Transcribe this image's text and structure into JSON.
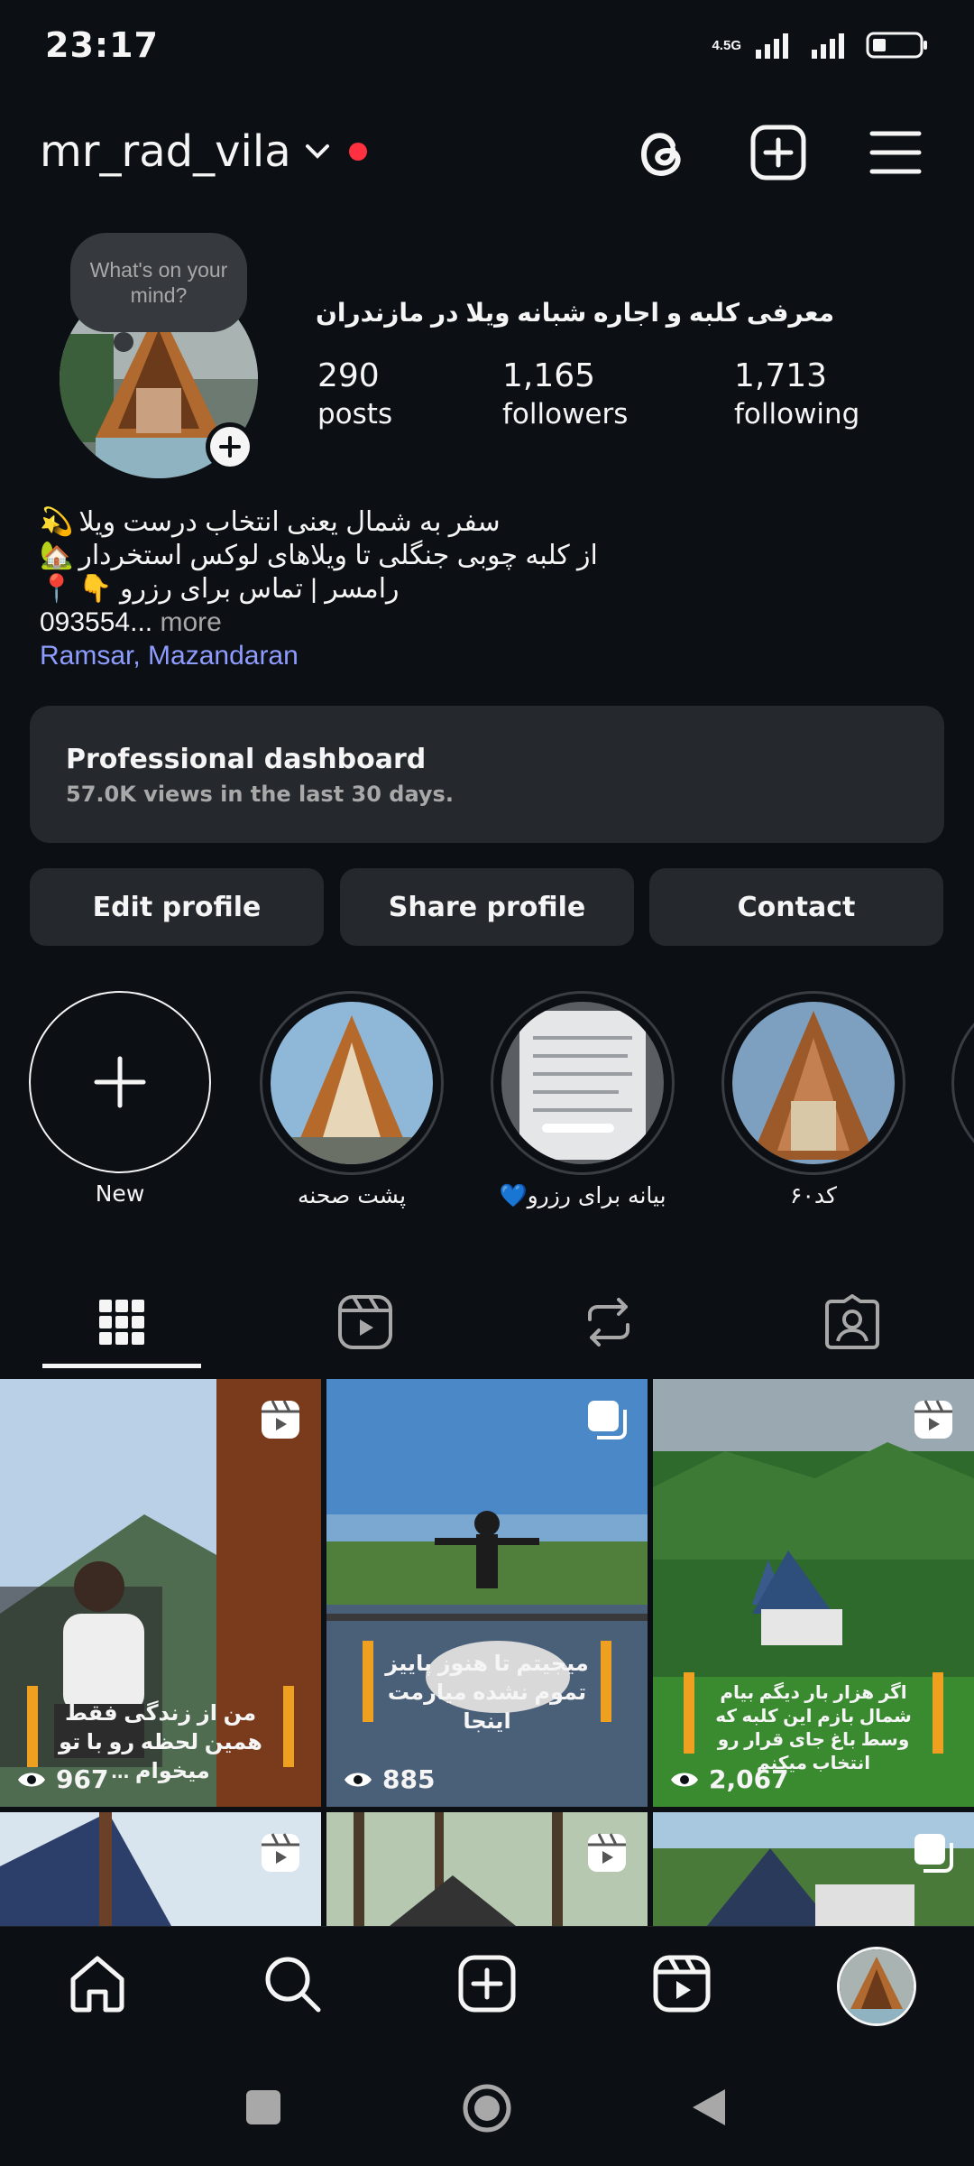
{
  "status_bar": {
    "time": "23:17",
    "network": "4.5G"
  },
  "header": {
    "username": "mr_rad_vila"
  },
  "profile": {
    "thought_bubble": "What's on your mind?",
    "business_name": "معرفی کلبه و اجاره شبانه ویلا در مازندران",
    "stats": [
      {
        "value": "290",
        "label": "posts"
      },
      {
        "value": "1,165",
        "label": "followers"
      },
      {
        "value": "1,713",
        "label": "following"
      }
    ],
    "bio_lines": [
      {
        "emoji": "💫",
        "text": "سفر به شمال یعنی انتخاب درست ویلا"
      },
      {
        "emoji": "🏡",
        "text": "از کلبه چوبی جنگلی تا ویلاهای لوکس استخردار"
      },
      {
        "emoji": "📍",
        "text": "رامسر | تماس برای رزرو 👇"
      }
    ],
    "phone": "093554...",
    "more": " more",
    "location": "Ramsar, Mazandaran"
  },
  "dashboard": {
    "title": "Professional dashboard",
    "subtitle": "57.0K views in the last 30 days."
  },
  "buttons": {
    "edit": "Edit profile",
    "share": "Share profile",
    "contact": "Contact"
  },
  "highlights": [
    {
      "label": "New"
    },
    {
      "label": "پشت صحنه"
    },
    {
      "label": "بیانه برای رزرو💙"
    },
    {
      "label": "کد۶۰"
    }
  ],
  "posts": [
    {
      "views": "967",
      "caption": "من از زندگی فقط همین لحظه رو با تو میخوام ...",
      "type": "reel"
    },
    {
      "views": "885",
      "caption": "میجیتم تا هنوز پاییز تموم نشده میارمت اینجا",
      "type": "carousel"
    },
    {
      "views": "2,067",
      "caption": "اگر هزار بار دیگم بیام شمال بازم این کلبه که وسط باغ جای قرار رو انتخاب میکنم",
      "type": "reel"
    },
    {
      "views": "",
      "caption": "",
      "type": "reel"
    },
    {
      "views": "",
      "caption": "",
      "type": "reel"
    },
    {
      "views": "",
      "caption": "",
      "type": "carousel"
    }
  ],
  "colors": {
    "background": "#0c1014",
    "surface": "#25292e",
    "link": "#8e9cff",
    "live_dot": "#ff3040"
  }
}
